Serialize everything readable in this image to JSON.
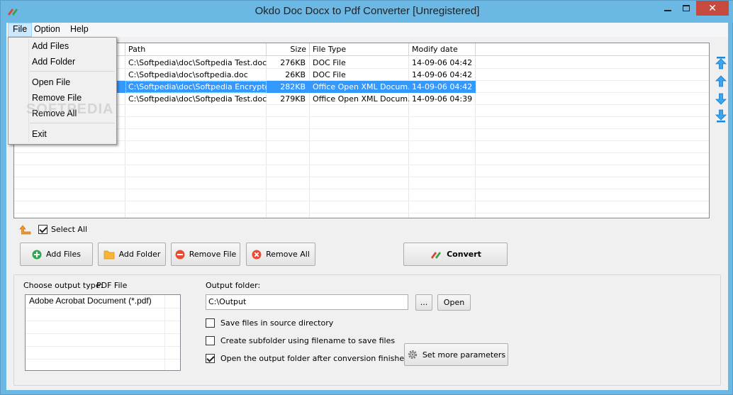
{
  "window": {
    "title": "Okdo Doc Docx to Pdf Converter [Unregistered]",
    "close_glyph": "✕"
  },
  "menubar": {
    "items": [
      "File",
      "Option",
      "Help"
    ]
  },
  "file_menu": {
    "items": [
      "Add Files",
      "Add Folder",
      "Open File",
      "Remove File",
      "Remove All",
      "Exit"
    ]
  },
  "filelist": {
    "columns": [
      "Path",
      "Size",
      "File Type",
      "Modify date"
    ],
    "rows": [
      {
        "path": "C:\\Softpedia\\doc\\Softpedia Test.doc",
        "size": "276KB",
        "type": "DOC File",
        "date": "14-09-06 04:42"
      },
      {
        "path": "C:\\Softpedia\\doc\\softpedia.doc",
        "size": "26KB",
        "type": "DOC File",
        "date": "14-09-06 04:42"
      },
      {
        "path": "C:\\Softpedia\\doc\\Softpedia Encrypte...",
        "size": "282KB",
        "type": "Office Open XML Docum...",
        "date": "14-09-06 04:42"
      },
      {
        "path": "C:\\Softpedia\\doc\\Softpedia Test.docx",
        "size": "279KB",
        "type": "Office Open XML Docum...",
        "date": "14-09-06 04:39"
      }
    ],
    "selected_row": 2,
    "watermark": "SOFTPEDIA"
  },
  "select_all": {
    "label": "Select All",
    "checked": true
  },
  "buttons": {
    "add_files": "Add Files",
    "add_folder": "Add Folder",
    "remove_file": "Remove File",
    "remove_all": "Remove All",
    "convert": "Convert"
  },
  "output": {
    "choose_type_label": "Choose output type:",
    "choose_type_value": "PDF File",
    "types": [
      "Adobe Acrobat Document (*.pdf)"
    ],
    "folder_label": "Output folder:",
    "folder_value": "C:\\Output",
    "browse_label": "...",
    "open_label": "Open",
    "options": [
      {
        "label": "Save files in source directory",
        "checked": false
      },
      {
        "label": "Create subfolder using filename to save files",
        "checked": false
      },
      {
        "label": "Open the output folder after conversion finished",
        "checked": true
      }
    ],
    "params_label": "Set more parameters"
  },
  "colors": {
    "titlebar": "#6cb8e4",
    "selection": "#3399ff",
    "close_button": "#c74a3e"
  }
}
